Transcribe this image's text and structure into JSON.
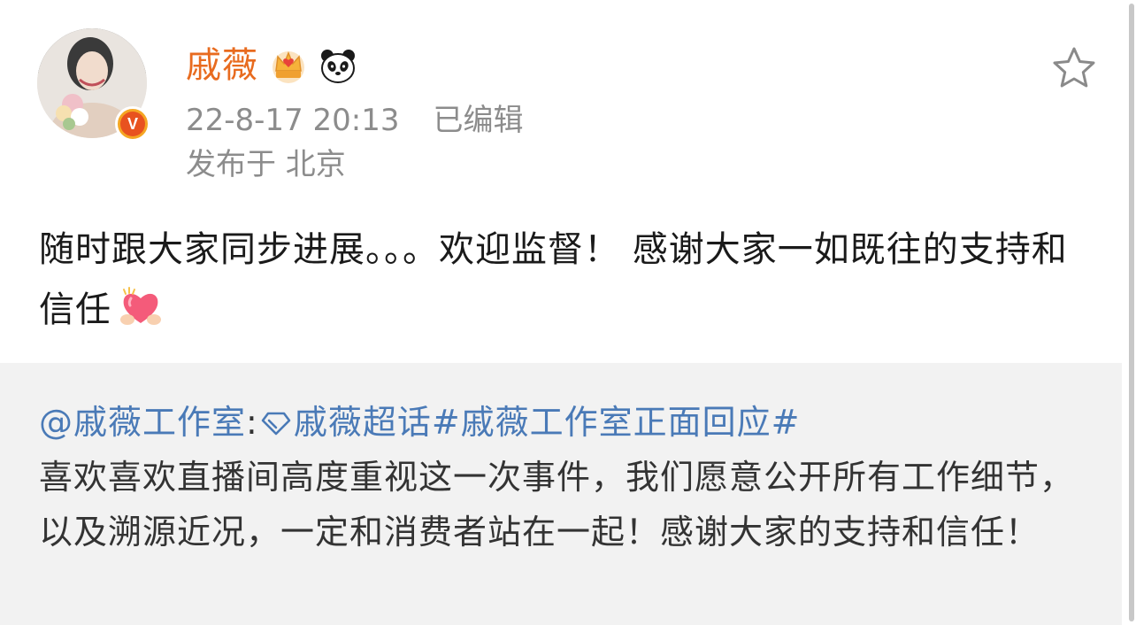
{
  "post": {
    "author": {
      "name": "戚薇",
      "verified": "V",
      "badges": [
        "crown-badge-icon",
        "panda-icon"
      ]
    },
    "timestamp": "22-8-17 20:13",
    "edited": "已编辑",
    "location": "发布于 北京",
    "text": "随时跟大家同步进展。。。欢迎监督！ 感谢大家一如既往的支持和信任",
    "emoji": "heart-hands-emoji",
    "favorite_icon": "star-outline-icon"
  },
  "repost": {
    "mention": "@戚薇工作室",
    "separator": ":",
    "supertopic": "戚薇超话",
    "hashtag": "#戚薇工作室正面回应#",
    "body": "喜欢喜欢直播间高度重视这一次事件，我们愿意公开所有工作细节，以及溯源近况，一定和消费者站在一起！感谢大家的支持和信任！"
  },
  "colors": {
    "username": "#e86b1f",
    "meta": "#8c8c8c",
    "link": "#4a7ab7",
    "repost_bg": "#f2f2f2",
    "text": "#1a1a1a"
  }
}
